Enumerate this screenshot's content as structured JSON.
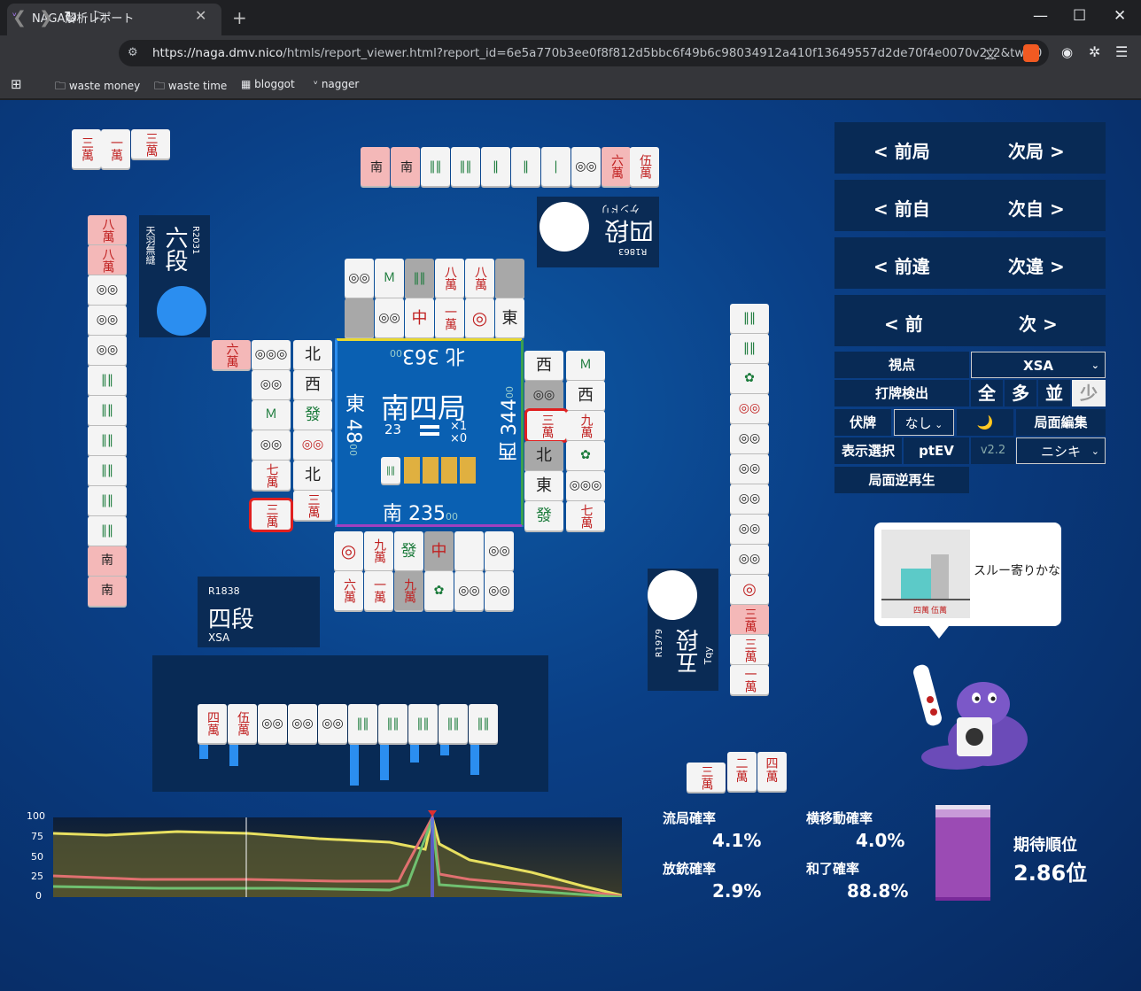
{
  "browser": {
    "tab_title": "NAGA解析レポート",
    "url_host": "https://naga.dmv.nico",
    "url_path": "/htmls/report_viewer.html?report_id=6e5a770b3ee0f8f812d5bbc6f49b6c98034912a410f13649557d2de70f4e0070v2_2&tw=0",
    "bookmarks": [
      "waste money",
      "waste time",
      "bloggot",
      "nagger"
    ]
  },
  "round": {
    "name": "南四局",
    "honba": "23",
    "riichi_sticks": "×1",
    "honba_sticks": "×0",
    "scores": {
      "north": "北 363",
      "east": "東 48",
      "west": "西 344",
      "south": "南 235"
    },
    "score_suffix": "00"
  },
  "players": {
    "top": {
      "rank": "四段",
      "name": "ケンドリ",
      "rating": "R1863"
    },
    "left": {
      "rank": "六段",
      "name": "天羽無縫",
      "rating": "R2031"
    },
    "bottom": {
      "rank": "四段",
      "name": "XSA",
      "rating": "R1838"
    },
    "right": {
      "rank": "五段",
      "name": "Tqy",
      "rating": "R1979"
    }
  },
  "controls": {
    "prev_round": "< 前局",
    "next_round": "次局 >",
    "prev_self": "< 前自",
    "next_self": "次自 >",
    "prev_diff": "< 前違",
    "next_diff": "次違 >",
    "prev": "< 前",
    "next": "次 >",
    "viewpoint_label": "視点",
    "viewpoint_value": "XSA",
    "detect_label": "打牌検出",
    "detect_all": "全",
    "detect_many": "多",
    "detect_normal": "並",
    "detect_few": "少",
    "hidden_label": "伏牌",
    "hidden_value": "なし",
    "moon": "🌙",
    "edit_label": "局面編集",
    "display_label": "表示選択",
    "ptev": "ptEV",
    "version": "v2.2",
    "model_value": "ニシキ",
    "reverse_label": "局面逆再生"
  },
  "comment": {
    "text": "スルー寄りかな",
    "tile1": "四萬",
    "tile2": "伍萬"
  },
  "hand": [
    "四萬",
    "伍萬",
    "6p",
    "7p",
    "8p",
    "4s",
    "5s",
    "6s",
    "7s",
    "8s"
  ],
  "hand_bars": [
    0,
    0,
    0,
    0,
    0,
    60,
    60,
    30,
    20,
    30
  ],
  "stats": {
    "ryukyoku_label": "流局確率",
    "ryukyoku_value": "4.1%",
    "yoko_label": "横移動確率",
    "yoko_value": "4.0%",
    "houju_label": "放銃確率",
    "houju_value": "2.9%",
    "agari_label": "和了確率",
    "agari_value": "88.8%",
    "expected_label": "期待順位",
    "expected_value": "2.86位"
  },
  "graph": {
    "yticks": [
      "100",
      "75",
      "50",
      "25",
      "0"
    ]
  }
}
